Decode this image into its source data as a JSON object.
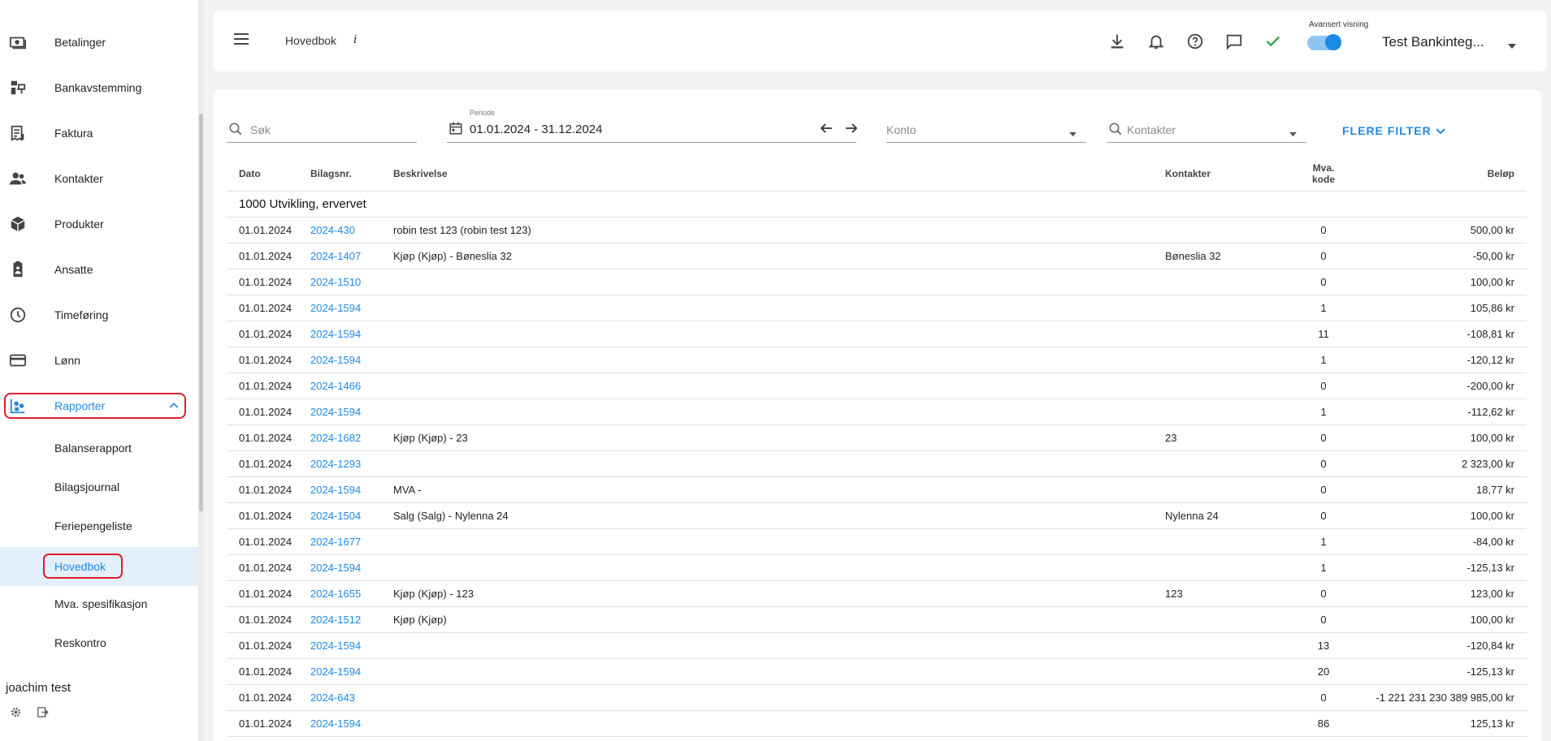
{
  "sidebar": {
    "items": [
      {
        "label": "Betalinger",
        "icon": "payments-icon"
      },
      {
        "label": "Bankavstemming",
        "icon": "bank-reconciliation-icon"
      },
      {
        "label": "Faktura",
        "icon": "invoice-icon"
      },
      {
        "label": "Kontakter",
        "icon": "contacts-icon"
      },
      {
        "label": "Produkter",
        "icon": "products-icon"
      },
      {
        "label": "Ansatte",
        "icon": "employees-icon"
      },
      {
        "label": "Timeføring",
        "icon": "clock-icon"
      },
      {
        "label": "Lønn",
        "icon": "payroll-card-icon"
      },
      {
        "label": "Rapporter",
        "icon": "reports-icon"
      }
    ],
    "sub_items": [
      {
        "label": "Balanserapport"
      },
      {
        "label": "Bilagsjournal"
      },
      {
        "label": "Feriepengeliste"
      },
      {
        "label": "Hovedbok"
      },
      {
        "label": "Mva. spesifikasjon"
      },
      {
        "label": "Reskontro"
      }
    ],
    "user_name": "joachim test"
  },
  "header": {
    "title": "Hovedbok",
    "info": "i",
    "advanced_label": "Avansert visning",
    "advanced_on": true,
    "company": "Test Bankinteg..."
  },
  "filters": {
    "search_placeholder": "Søk",
    "period_label": "Periode",
    "period_value": "01.01.2024 - 31.12.2024",
    "account_placeholder": "Konto",
    "contacts_placeholder": "Kontakter",
    "more_filters": "FLERE FILTER"
  },
  "table": {
    "headers": {
      "date": "Dato",
      "voucher": "Bilagsnr.",
      "description": "Beskrivelse",
      "contacts": "Kontakter",
      "vat_line1": "Mva.",
      "vat_line2": "kode",
      "amount": "Beløp"
    },
    "group": "1000 Utvikling, ervervet",
    "rows": [
      {
        "date": "01.01.2024",
        "voucher": "2024-430",
        "description": "robin test 123 (robin test 123)",
        "contact": "",
        "vat": "0",
        "amount": "500,00 kr"
      },
      {
        "date": "01.01.2024",
        "voucher": "2024-1407",
        "description": "Kjøp (Kjøp) - Bøneslia 32",
        "contact": "Bøneslia 32",
        "vat": "0",
        "amount": "-50,00 kr"
      },
      {
        "date": "01.01.2024",
        "voucher": "2024-1510",
        "description": "",
        "contact": "",
        "vat": "0",
        "amount": "100,00 kr"
      },
      {
        "date": "01.01.2024",
        "voucher": "2024-1594",
        "description": "",
        "contact": "",
        "vat": "1",
        "amount": "105,86 kr"
      },
      {
        "date": "01.01.2024",
        "voucher": "2024-1594",
        "description": "",
        "contact": "",
        "vat": "11",
        "amount": "-108,81 kr"
      },
      {
        "date": "01.01.2024",
        "voucher": "2024-1594",
        "description": "",
        "contact": "",
        "vat": "1",
        "amount": "-120,12 kr"
      },
      {
        "date": "01.01.2024",
        "voucher": "2024-1466",
        "description": "",
        "contact": "",
        "vat": "0",
        "amount": "-200,00 kr"
      },
      {
        "date": "01.01.2024",
        "voucher": "2024-1594",
        "description": "",
        "contact": "",
        "vat": "1",
        "amount": "-112,62 kr"
      },
      {
        "date": "01.01.2024",
        "voucher": "2024-1682",
        "description": "Kjøp (Kjøp) - 23",
        "contact": "23",
        "vat": "0",
        "amount": "100,00 kr"
      },
      {
        "date": "01.01.2024",
        "voucher": "2024-1293",
        "description": "",
        "contact": "",
        "vat": "0",
        "amount": "2 323,00 kr"
      },
      {
        "date": "01.01.2024",
        "voucher": "2024-1594",
        "description": "MVA -",
        "contact": "",
        "vat": "0",
        "amount": "18,77 kr"
      },
      {
        "date": "01.01.2024",
        "voucher": "2024-1504",
        "description": "Salg (Salg) - Nylenna 24",
        "contact": "Nylenna 24",
        "vat": "0",
        "amount": "100,00 kr"
      },
      {
        "date": "01.01.2024",
        "voucher": "2024-1677",
        "description": "",
        "contact": "",
        "vat": "1",
        "amount": "-84,00 kr"
      },
      {
        "date": "01.01.2024",
        "voucher": "2024-1594",
        "description": "",
        "contact": "",
        "vat": "1",
        "amount": "-125,13 kr"
      },
      {
        "date": "01.01.2024",
        "voucher": "2024-1655",
        "description": "Kjøp (Kjøp) - 123",
        "contact": "123",
        "vat": "0",
        "amount": "123,00 kr"
      },
      {
        "date": "01.01.2024",
        "voucher": "2024-1512",
        "description": "Kjøp (Kjøp)",
        "contact": "",
        "vat": "0",
        "amount": "100,00 kr"
      },
      {
        "date": "01.01.2024",
        "voucher": "2024-1594",
        "description": "",
        "contact": "",
        "vat": "13",
        "amount": "-120,84 kr"
      },
      {
        "date": "01.01.2024",
        "voucher": "2024-1594",
        "description": "",
        "contact": "",
        "vat": "20",
        "amount": "-125,13 kr"
      },
      {
        "date": "01.01.2024",
        "voucher": "2024-643",
        "description": "",
        "contact": "",
        "vat": "0",
        "amount": "-1 221 231 230 389 985,00 kr"
      },
      {
        "date": "01.01.2024",
        "voucher": "2024-1594",
        "description": "",
        "contact": "",
        "vat": "86",
        "amount": "125,13 kr"
      }
    ]
  }
}
